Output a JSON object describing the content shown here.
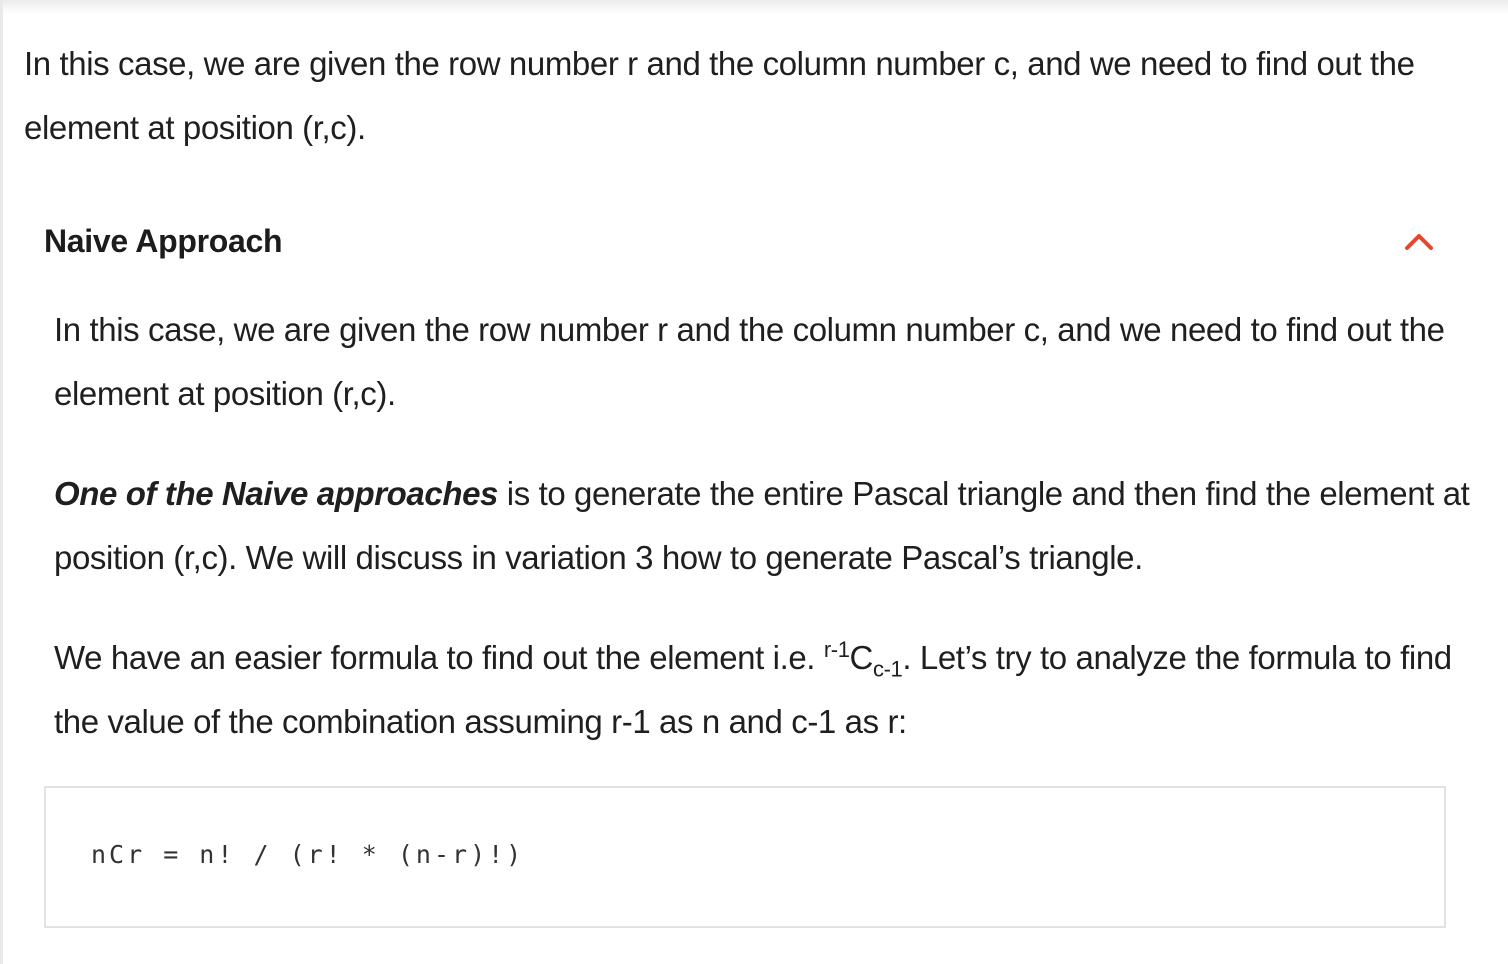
{
  "intro": {
    "text": "In this case, we are given the row number r and the column number c, and we need to find out the element at position (r,c)."
  },
  "accordion": {
    "title": "Naive Approach",
    "toggle_icon": "chevron-up-icon",
    "accent_color": "#e8452c",
    "expanded": true,
    "paragraph1": "In this case, we are given the row number r and the column number c, and we need to find out the element at position (r,c).",
    "paragraph2": {
      "emphasis": "One of the Naive approaches",
      "rest": " is to generate the entire Pascal triangle and then find the element at position (r,c). We will discuss in variation 3 how to generate Pascal’s triangle."
    },
    "paragraph3": {
      "before": "We have an easier formula to find out the element i.e. ",
      "sup": "r-1",
      "base": "C",
      "sub": "c-1",
      "after": ". Let’s try to analyze the formula to find the value of the combination assuming r-1 as n and c-1 as r:"
    }
  },
  "code": {
    "line": "nCr = n! / (r! * (n-r)!)"
  }
}
